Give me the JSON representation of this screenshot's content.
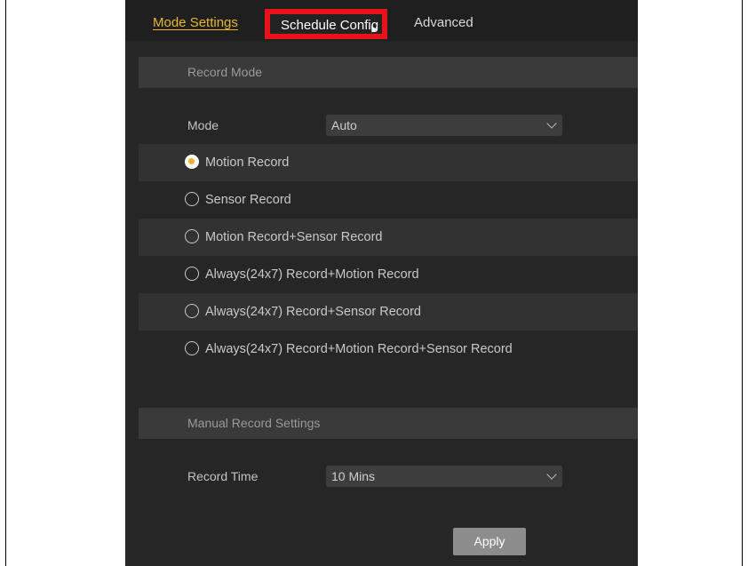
{
  "tabs": {
    "mode_settings": "Mode Settings",
    "schedule_config": "Schedule Config",
    "advanced": "Advanced"
  },
  "record_mode": {
    "header": "Record Mode",
    "mode_label": "Mode",
    "mode_value": "Auto",
    "options": [
      {
        "label": "Motion Record",
        "checked": true
      },
      {
        "label": "Sensor Record",
        "checked": false
      },
      {
        "label": "Motion Record+Sensor Record",
        "checked": false
      },
      {
        "label": "Always(24x7) Record+Motion Record",
        "checked": false
      },
      {
        "label": "Always(24x7) Record+Sensor Record",
        "checked": false
      },
      {
        "label": "Always(24x7) Record+Motion Record+Sensor Record",
        "checked": false
      }
    ]
  },
  "manual_record": {
    "header": "Manual Record Settings",
    "record_time_label": "Record Time",
    "record_time_value": "10 Mins"
  },
  "actions": {
    "apply": "Apply"
  },
  "colors": {
    "accent": "#e6b531",
    "highlight_box": "#e8131a",
    "panel_bg": "#262626"
  }
}
